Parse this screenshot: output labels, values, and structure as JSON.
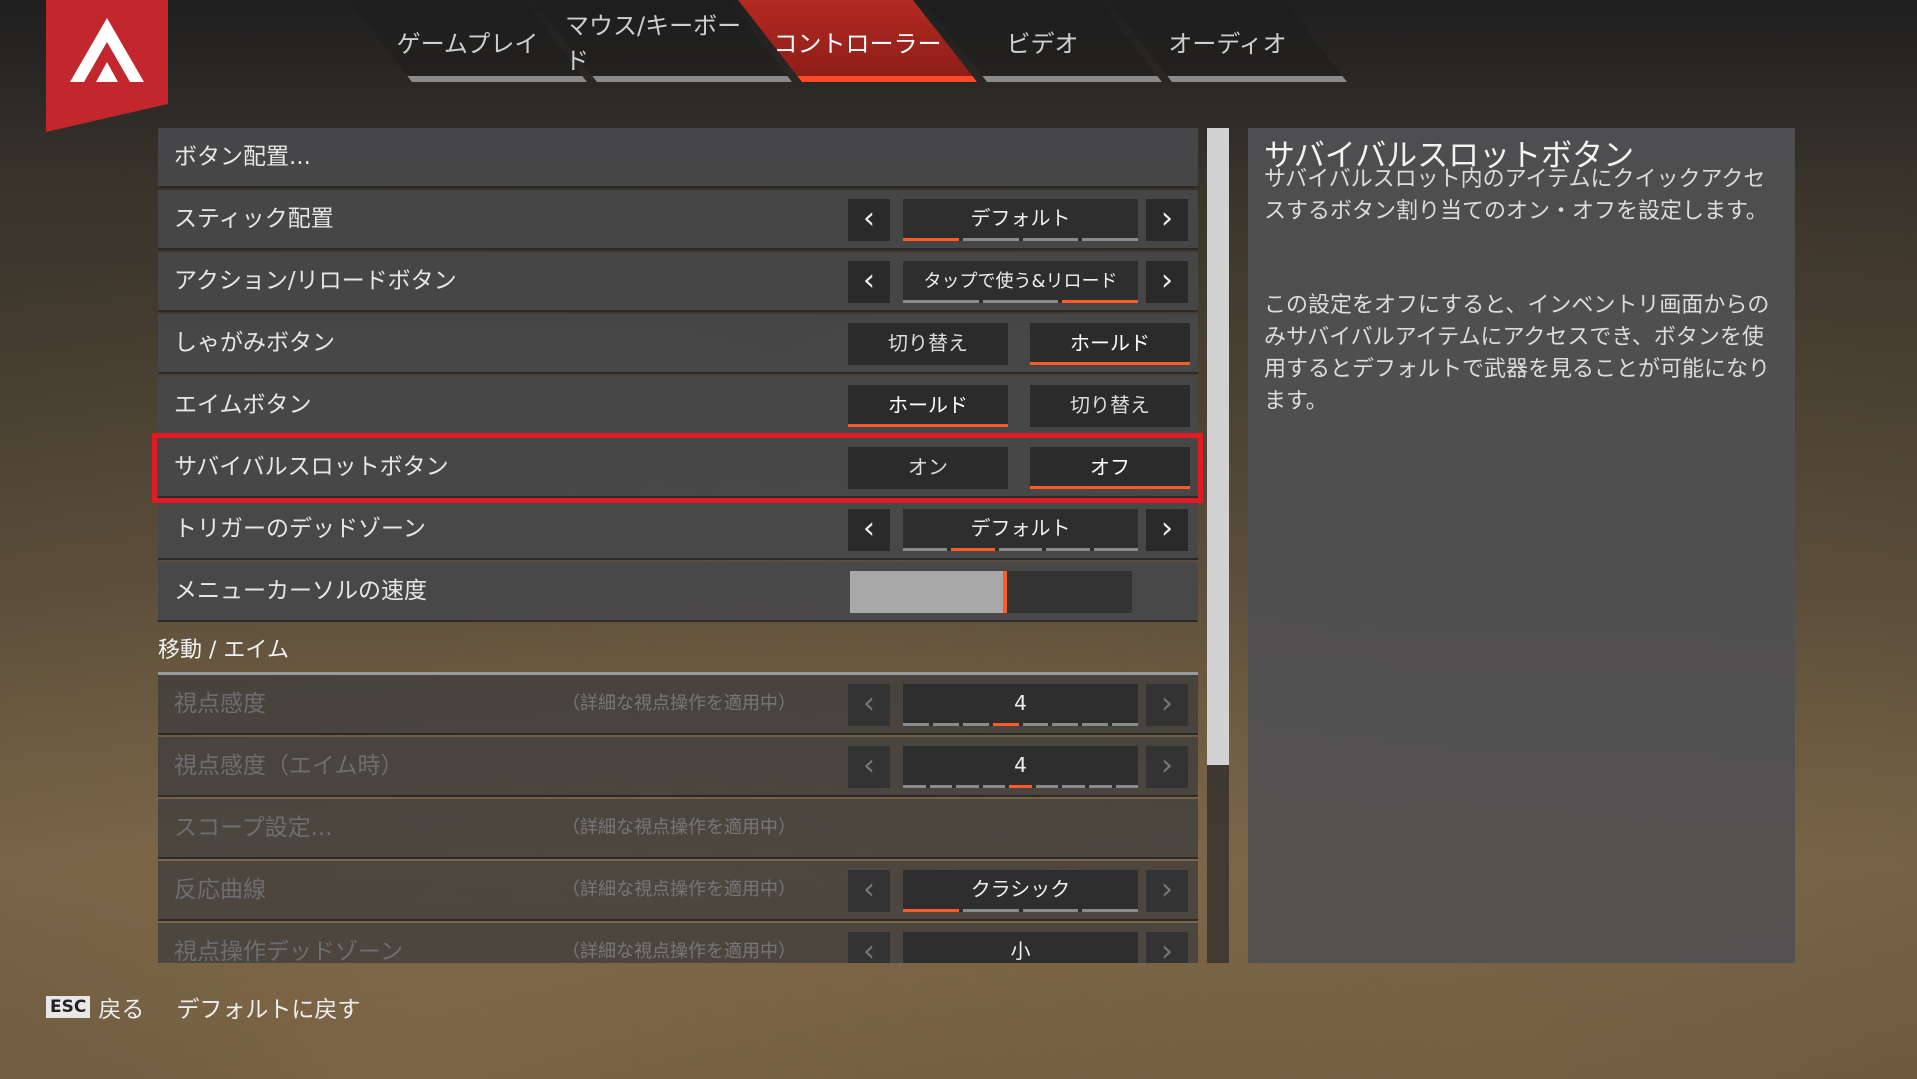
{
  "tabs": [
    {
      "label": "ゲームプレイ",
      "active": false
    },
    {
      "label": "マウス/キーボード",
      "active": false
    },
    {
      "label": "コントローラー",
      "active": true
    },
    {
      "label": "ビデオ",
      "active": false
    },
    {
      "label": "オーディオ",
      "active": false
    }
  ],
  "settings": {
    "button_layout": "ボタン配置...",
    "stick_layout": {
      "label": "スティック配置",
      "value": "デフォルト"
    },
    "action_reload": {
      "label": "アクション/リロードボタン",
      "value": "タップで使う&リロード"
    },
    "crouch": {
      "label": "しゃがみボタン",
      "opt_a": "切り替え",
      "opt_b": "ホールド",
      "selected": "ホールド"
    },
    "aim": {
      "label": "エイムボタン",
      "opt_a": "ホールド",
      "opt_b": "切り替え",
      "selected": "ホールド"
    },
    "survival_slot": {
      "label": "サバイバルスロットボタン",
      "opt_a": "オン",
      "opt_b": "オフ",
      "selected": "オフ"
    },
    "trigger_deadzone": {
      "label": "トリガーのデッドゾーン",
      "value": "デフォルト"
    },
    "menu_cursor_speed": {
      "label": "メニューカーソルの速度",
      "level": 0.55
    }
  },
  "section_move_aim": "移動 / エイム",
  "move_aim": {
    "look_sensitivity": {
      "label": "視点感度",
      "note": "（詳細な視点操作を適用中）",
      "value": "4"
    },
    "look_sensitivity_ads": {
      "label": "視点感度（エイム時）",
      "value": "4"
    },
    "scope_settings": {
      "label": "スコープ設定...",
      "note": "（詳細な視点操作を適用中）"
    },
    "response_curve": {
      "label": "反応曲線",
      "note": "（詳細な視点操作を適用中）",
      "value": "クラシック"
    },
    "look_deadzone": {
      "label": "視点操作デッドゾーン",
      "note": "（詳細な視点操作を適用中）",
      "value": "小"
    }
  },
  "description": {
    "title": "サバイバルスロットボタン",
    "para1": "サバイバルスロット内のアイテムにクイックアクセスするボタン割り当てのオン・オフを設定します。",
    "para2": "この設定をオフにすると、インベントリ画面からのみサバイバルアイテムにアクセスでき、ボタンを使用するとデフォルトで武器を見ることが可能になります。"
  },
  "footer": {
    "esc_key": "ESC",
    "back": "戻る",
    "reset_default": "デフォルトに戻す"
  },
  "colors": {
    "accent": "#ff5a2a",
    "tab_active": "#b32a22",
    "highlight": "#e01b24"
  }
}
